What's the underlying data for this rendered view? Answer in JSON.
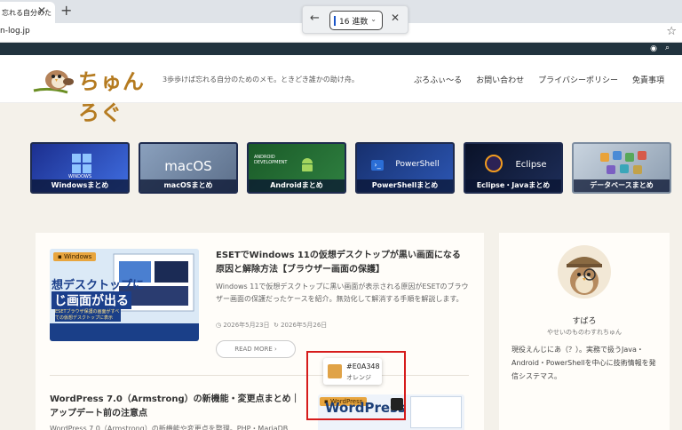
{
  "browser": {
    "tab_title": "忘れる自分のた",
    "url": "n-log.jp",
    "find": {
      "selected": "16 進数"
    }
  },
  "site": {
    "logo_text": "ちゅんろぐ",
    "tagline": "3歩歩けば忘れる自分のためのメモ。ときどき誰かの助け舟。",
    "nav": [
      "ぶろふぃ〜る",
      "お問い合わせ",
      "プライバシーポリシー",
      "免責事項"
    ]
  },
  "categories": [
    {
      "label": "Windowsまとめ",
      "title": "WINDOWS",
      "color": "#2a4cc4"
    },
    {
      "label": "macOSまとめ",
      "title": "macOS",
      "color": "#6f86a3"
    },
    {
      "label": "Androidまとめ",
      "title": "ANDROID DEVELOPMENT",
      "color": "#1f6a2f"
    },
    {
      "label": "PowerShellまとめ",
      "title": "PowerShell",
      "color": "#1d3d8a"
    },
    {
      "label": "Eclipse・Javaまとめ",
      "title": "Eclipse",
      "color": "#0d1830"
    },
    {
      "label": "データベースまとめ",
      "title": "",
      "color": "#9fb0c2"
    }
  ],
  "posts": [
    {
      "badge": "Windows",
      "title": "ESETでWindows 11の仮想デスクトップが黒い画面になる原因と解除方法【ブラウザー画面の保護】",
      "excerpt": "Windows 11で仮想デスクトップに黒い画面が表示される原因がESETのブラウザー画面の保護だったケースを紹介。無効化して解消する手順を解説します。",
      "date": "2026年5月23日",
      "updated": "2026年5月26日",
      "readmore": "READ MORE ›",
      "thumb_text": [
        "想デスクトップに",
        "じ画面が出る"
      ],
      "thumb_sub": "ESETブラウザ保護の画面がすべての仮想デスクトップに表示"
    },
    {
      "badge": "WordPress",
      "title": "WordPress 7.0（Armstrong）の新機能・変更点まとめ｜アップデート前の注意点",
      "excerpt": "WordPress 7.0（Armstrong）の新機能や変更点を整理。PHP・MariaDB",
      "thumb_text": "WordPress"
    }
  ],
  "sidebar": {
    "name": "すばろ",
    "subtitle": "やせいのものわすれちゅん",
    "bio": "現役えんじにあ（？）。実務で扱うJava・Android・PowerShellを中心に技術情報を発信システマス。"
  },
  "picker": {
    "hex": "#E0A348",
    "name": "オレンジ",
    "color": "#E0A348"
  }
}
